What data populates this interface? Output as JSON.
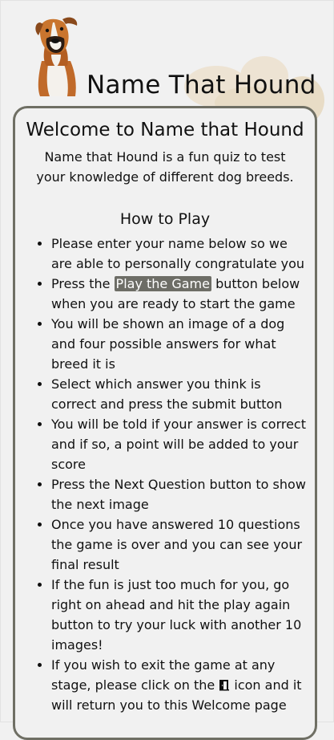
{
  "header": {
    "title": "Name That Hound",
    "logo_icon": "boxer-dog-logo"
  },
  "welcome": {
    "heading": "Welcome to Name that Hound",
    "intro": "Name that Hound is a fun quiz to test your knowledge of different dog breeds."
  },
  "how_to_play": {
    "heading": "How to Play",
    "rules": [
      {
        "text": "Please enter your name below so we are able to personally congratulate you"
      },
      {
        "before": "Press the ",
        "highlight": "Play the Game",
        "after": " button below when you are ready to start the game"
      },
      {
        "text": "You will be shown an image of a dog and four possible answers for what breed it is"
      },
      {
        "text": "Select which answer you think is correct and press the submit button"
      },
      {
        "text": "You will be told if your answer is correct and if so, a point will be added to your score"
      },
      {
        "text": "Press the Next Question button to show the next image"
      },
      {
        "text": "Once you have answered 10 questions the game is over and you can see your final result"
      },
      {
        "text": "If the fun is just too much for you, go right on ahead and hit the play again button to try your luck with another 10 images!"
      },
      {
        "before": "If you wish to exit the game at any stage, please click on the ",
        "icon": "door-exit-icon",
        "after": " icon and it will return you to this Welcome page"
      }
    ]
  },
  "colors": {
    "background": "#f1f1f1",
    "card_border": "#6f6f64",
    "highlight_bg": "#6d6d66",
    "highlight_text": "#ffffff"
  }
}
